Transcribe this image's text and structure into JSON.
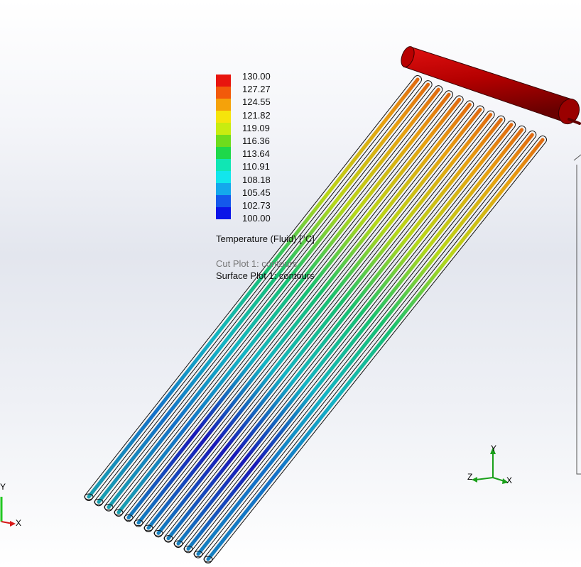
{
  "legend": {
    "values": [
      "130.00",
      "127.27",
      "124.55",
      "121.82",
      "119.09",
      "116.36",
      "113.64",
      "110.91",
      "108.18",
      "105.45",
      "102.73",
      "100.00"
    ],
    "colors": [
      "#e8140e",
      "#f25a0a",
      "#f5a20a",
      "#f5e40c",
      "#c8ec10",
      "#6edc1c",
      "#1ed84a",
      "#10e6b4",
      "#12e6ec",
      "#14a8ec",
      "#1458ec",
      "#0a14e8"
    ],
    "title": "Temperature (Fluid) [°C]",
    "cut_plot": "Cut Plot 1: contours",
    "surface_plot": "Surface Plot 1: contours"
  },
  "triad": {
    "x": "X",
    "y": "Y",
    "z": "Z"
  },
  "mini_triad": {
    "x": "X",
    "y": "Y"
  },
  "colors": {
    "header": "#c40000",
    "tube_hot": "#e8a010",
    "tube_mid": "#18c070",
    "tube_cold": "#1818b8",
    "outline": "#111111"
  }
}
